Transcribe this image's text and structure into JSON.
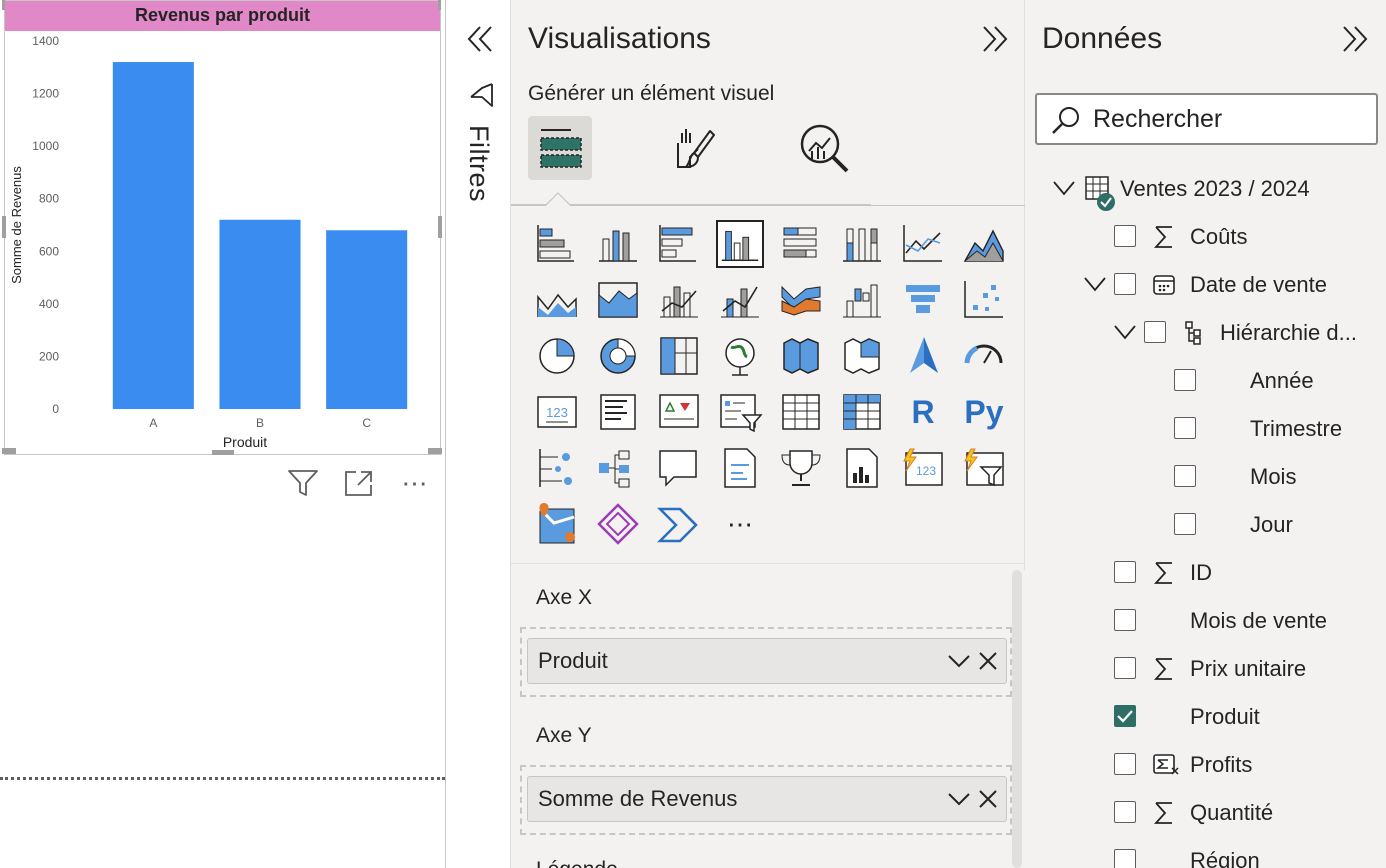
{
  "canvas": {
    "visual_title": "Revenus par produit",
    "title_bg_color": "#e088c8",
    "bar_color": "#3b8cf0",
    "toolbar": {
      "filter_icon": "funnel-icon",
      "focus_icon": "focus-mode-icon",
      "more_icon": "more-options-icon",
      "more_label": "⋯"
    }
  },
  "chart_data": {
    "type": "bar",
    "title": "Revenus par produit",
    "categories": [
      "A",
      "B",
      "C"
    ],
    "values": [
      1320,
      720,
      680
    ],
    "xlabel": "Produit",
    "ylabel": "Somme de Revenus",
    "ylim": [
      0,
      1400
    ],
    "yticks": [
      0,
      200,
      400,
      600,
      800,
      1000,
      1200,
      1400
    ],
    "grid": false
  },
  "filters_pane": {
    "label": "Filtres",
    "expand_icon": "double-chevron-left-icon",
    "funnel_icon": "funnel-icon"
  },
  "viz_pane": {
    "title": "Visualisations",
    "collapse_icon": "double-chevron-right-icon",
    "subtitle": "Générer un élément visuel",
    "tabs": [
      {
        "name": "build-visual-tab",
        "icon": "fields-icon",
        "active": true
      },
      {
        "name": "format-visual-tab",
        "icon": "paintbrush-icon",
        "active": false
      },
      {
        "name": "analytics-tab",
        "icon": "magnifier-chart-icon",
        "active": false
      }
    ],
    "visual_types": [
      "stacked-bar-chart",
      "stacked-column-chart",
      "clustered-bar-chart",
      "clustered-column-chart",
      "100-stacked-bar-chart",
      "100-stacked-column-chart",
      "line-chart",
      "area-chart",
      "stacked-area-chart",
      "100-stacked-area-chart",
      "line-and-stacked-column-chart",
      "line-and-clustered-column-chart",
      "ribbon-chart",
      "waterfall-chart",
      "funnel-chart",
      "scatter-chart",
      "pie-chart",
      "donut-chart",
      "treemap",
      "map",
      "filled-map",
      "shape-map",
      "azure-map",
      "gauge",
      "card",
      "multi-row-card",
      "kpi",
      "slicer",
      "table",
      "matrix",
      "r-script-visual",
      "python-visual",
      "key-influencers",
      "decomposition-tree",
      "q-and-a",
      "smart-narrative",
      "metrics",
      "paginated-report",
      "power-apps",
      "power-automate",
      "arcgis-map",
      "power-apps-visual",
      "power-automate-visual",
      "more-visuals"
    ],
    "selected_visual": "clustered-column-chart",
    "r_label": "R",
    "py_label": "Py",
    "more_label": "⋯",
    "wells": [
      {
        "label": "Axe X",
        "field": "Produit"
      },
      {
        "label": "Axe Y",
        "field": "Somme de Revenus"
      },
      {
        "label": "Légende",
        "field": ""
      }
    ]
  },
  "data_pane": {
    "title": "Données",
    "collapse_icon": "double-chevron-right-icon",
    "search_placeholder": "Rechercher",
    "table": "Ventes 2023 / 2024",
    "fields": [
      {
        "label": "Coûts",
        "icon": "sigma-icon",
        "checked": false
      },
      {
        "label": "Date de vente",
        "icon": "calendar-icon",
        "checked": false,
        "expanded": true
      },
      {
        "label": "Hiérarchie d...",
        "icon": "hierarchy-icon",
        "checked": false,
        "expanded": true
      },
      {
        "label": "Année",
        "icon": "",
        "checked": false
      },
      {
        "label": "Trimestre",
        "icon": "",
        "checked": false
      },
      {
        "label": "Mois",
        "icon": "",
        "checked": false
      },
      {
        "label": "Jour",
        "icon": "",
        "checked": false
      },
      {
        "label": "ID",
        "icon": "sigma-icon",
        "checked": false
      },
      {
        "label": "Mois de vente",
        "icon": "",
        "checked": false
      },
      {
        "label": "Prix unitaire",
        "icon": "sigma-icon",
        "checked": false
      },
      {
        "label": "Produit",
        "icon": "",
        "checked": true
      },
      {
        "label": "Profits",
        "icon": "calculated-measure-icon",
        "checked": false
      },
      {
        "label": "Quantité",
        "icon": "sigma-icon",
        "checked": false
      },
      {
        "label": "Région",
        "icon": "",
        "checked": false
      }
    ]
  },
  "colors": {
    "accent": "#2f6e66",
    "pane_bg": "#f3f2f1"
  }
}
